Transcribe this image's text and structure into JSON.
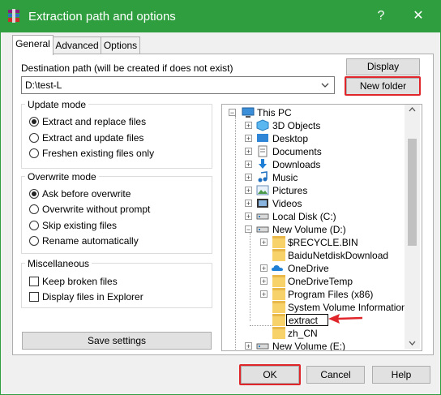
{
  "window": {
    "title": "Extraction path and options",
    "help_label": "?",
    "close_label": "✕"
  },
  "tabs": [
    {
      "label": "General"
    },
    {
      "label": "Advanced"
    },
    {
      "label": "Options"
    }
  ],
  "destination": {
    "label": "Destination path (will be created if does not exist)",
    "value": "D:\\test-L",
    "display_button": "Display",
    "new_folder_button": "New folder"
  },
  "update_mode": {
    "title": "Update mode",
    "options": [
      {
        "label": "Extract and replace files",
        "selected": true
      },
      {
        "label": "Extract and update files",
        "selected": false
      },
      {
        "label": "Freshen existing files only",
        "selected": false
      }
    ]
  },
  "overwrite_mode": {
    "title": "Overwrite mode",
    "options": [
      {
        "label": "Ask before overwrite",
        "selected": true
      },
      {
        "label": "Overwrite without prompt",
        "selected": false
      },
      {
        "label": "Skip existing files",
        "selected": false
      },
      {
        "label": "Rename automatically",
        "selected": false
      }
    ]
  },
  "misc": {
    "title": "Miscellaneous",
    "options": [
      {
        "label": "Keep broken files",
        "checked": false
      },
      {
        "label": "Display files in Explorer",
        "checked": false
      }
    ]
  },
  "save_settings": "Save settings",
  "tree": {
    "items": [
      {
        "label": "This PC",
        "icon": "computer-icon"
      },
      {
        "label": "3D Objects",
        "icon": "3d-objects-icon"
      },
      {
        "label": "Desktop",
        "icon": "desktop-icon"
      },
      {
        "label": "Documents",
        "icon": "documents-icon"
      },
      {
        "label": "Downloads",
        "icon": "downloads-icon"
      },
      {
        "label": "Music",
        "icon": "music-icon"
      },
      {
        "label": "Pictures",
        "icon": "pictures-icon"
      },
      {
        "label": "Videos",
        "icon": "videos-icon"
      },
      {
        "label": "Local Disk (C:)",
        "icon": "drive-icon"
      },
      {
        "label": "New Volume (D:)",
        "icon": "drive-icon"
      },
      {
        "label": "$RECYCLE.BIN",
        "icon": "folder-icon"
      },
      {
        "label": "BaiduNetdiskDownload",
        "icon": "folder-icon"
      },
      {
        "label": "OneDrive",
        "icon": "onedrive-icon"
      },
      {
        "label": "OneDriveTemp",
        "icon": "folder-icon"
      },
      {
        "label": "Program Files (x86)",
        "icon": "folder-icon"
      },
      {
        "label": "System Volume Information",
        "icon": "folder-icon"
      },
      {
        "label": "extract",
        "icon": "folder-icon"
      },
      {
        "label": "zh_CN",
        "icon": "folder-icon"
      },
      {
        "label": "New Volume (E:)",
        "icon": "drive-icon"
      }
    ],
    "rename_value": "extract"
  },
  "buttons": {
    "ok": "OK",
    "cancel": "Cancel",
    "help": "Help"
  },
  "colors": {
    "titlebar": "#2e9e3e",
    "highlight": "#e0262b"
  }
}
